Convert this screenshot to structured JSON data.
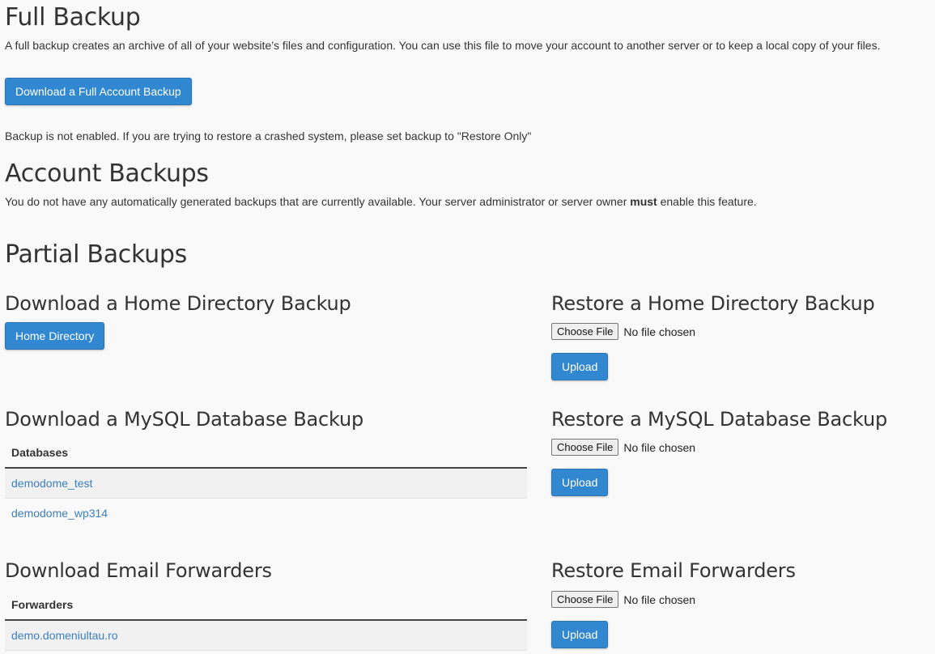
{
  "full_backup": {
    "title": "Full Backup",
    "description": "A full backup creates an archive of all of your website’s files and configuration. You can use this file to move your account to another server or to keep a local copy of your files.",
    "download_button": "Download a Full Account Backup",
    "notice": "Backup is not enabled. If you are trying to restore a crashed system, please set backup to \"Restore Only\""
  },
  "account_backups": {
    "title": "Account Backups",
    "text_before": "You do not have any automatically generated backups that are currently available. Your server administrator or server owner ",
    "text_bold": "must",
    "text_after": " enable this feature."
  },
  "partial_backups": {
    "title": "Partial Backups",
    "home": {
      "download_title": "Download a Home Directory Backup",
      "download_button": "Home Directory",
      "restore_title": "Restore a Home Directory Backup",
      "choose_label": "Choose File",
      "no_file": "No file chosen",
      "upload_button": "Upload"
    },
    "mysql": {
      "download_title": "Download a MySQL Database Backup",
      "column_header": "Databases",
      "rows": [
        "demodome_test",
        "demodome_wp314"
      ],
      "restore_title": "Restore a MySQL Database Backup",
      "choose_label": "Choose File",
      "no_file": "No file chosen",
      "upload_button": "Upload"
    },
    "email": {
      "download_title": "Download Email Forwarders",
      "column_header": "Forwarders",
      "rows": [
        "demo.domeniultau.ro"
      ],
      "restore_title": "Restore Email Forwarders",
      "choose_label": "Choose File",
      "no_file": "No file chosen",
      "upload_button": "Upload"
    }
  }
}
